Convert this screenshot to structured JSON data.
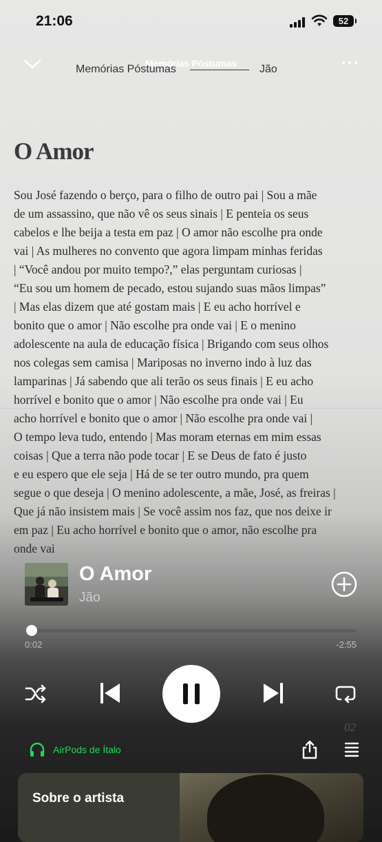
{
  "status_bar": {
    "time": "21:06",
    "battery": "52"
  },
  "header": {
    "title": "Memórias Póstumas"
  },
  "lyric_sheet": {
    "album_header": "Memórias Póstumas",
    "artist_header": "Jão",
    "title": "O Amor",
    "lines": [
      "Sou José fazendo o berço, para o filho de outro pai | Sou a mãe",
      "de um assassino, que não vê os seus sinais | E penteia os seus",
      "cabelos e lhe beija a testa em paz | O amor não escolhe pra onde",
      "vai | As mulheres no convento que agora limpam minhas feridas",
      "| “Você andou por muito tempo?,” elas perguntam curiosas |",
      "“Eu sou um homem de pecado, estou sujando suas mãos limpas”",
      "| Mas elas dizem que até gostam mais | E eu acho horrível e",
      "bonito que o amor | Não escolhe pra onde vai | E o menino",
      "adolescente na aula de educação física | Brigando com seus olhos",
      "nos colegas sem camisa | Mariposas no inverno indo à luz das",
      "lamparinas | Já sabendo que ali terão os seus finais | E eu acho",
      "horrível e bonito que o amor  | Não escolhe pra onde vai  | Eu",
      "acho horrível e bonito que o amor | Não escolhe pra onde vai |",
      "O tempo leva tudo, entendo | Mas moram eternas em mim essas",
      "coisas | Que a terra não pode tocar | E se Deus de fato é justo",
      "e eu espero que ele seja | Há de se ter outro mundo, pra quem",
      "segue o que deseja | O menino adolescente, a mãe, José, as freiras |",
      "Que já não insistem mais | Se você assim nos faz, que nos deixe ir",
      "em paz | Eu acho horrível e bonito que o amor, não escolhe pra",
      "onde vai"
    ],
    "page_number": "02"
  },
  "now_playing": {
    "title": "O Amor",
    "artist": "Jão",
    "elapsed": "0:02",
    "remaining": "-2:55",
    "progress": 0.012
  },
  "device": {
    "label": "AirPods de Ítalo",
    "color": "#1ed760"
  },
  "artist_card": {
    "label": "Sobre o artista"
  },
  "icons": [
    "chevron-down-icon",
    "more-icon",
    "add-circle-icon",
    "shuffle-icon",
    "previous-icon",
    "pause-icon",
    "next-icon",
    "repeat-icon",
    "headphones-icon",
    "share-icon",
    "queue-icon"
  ]
}
